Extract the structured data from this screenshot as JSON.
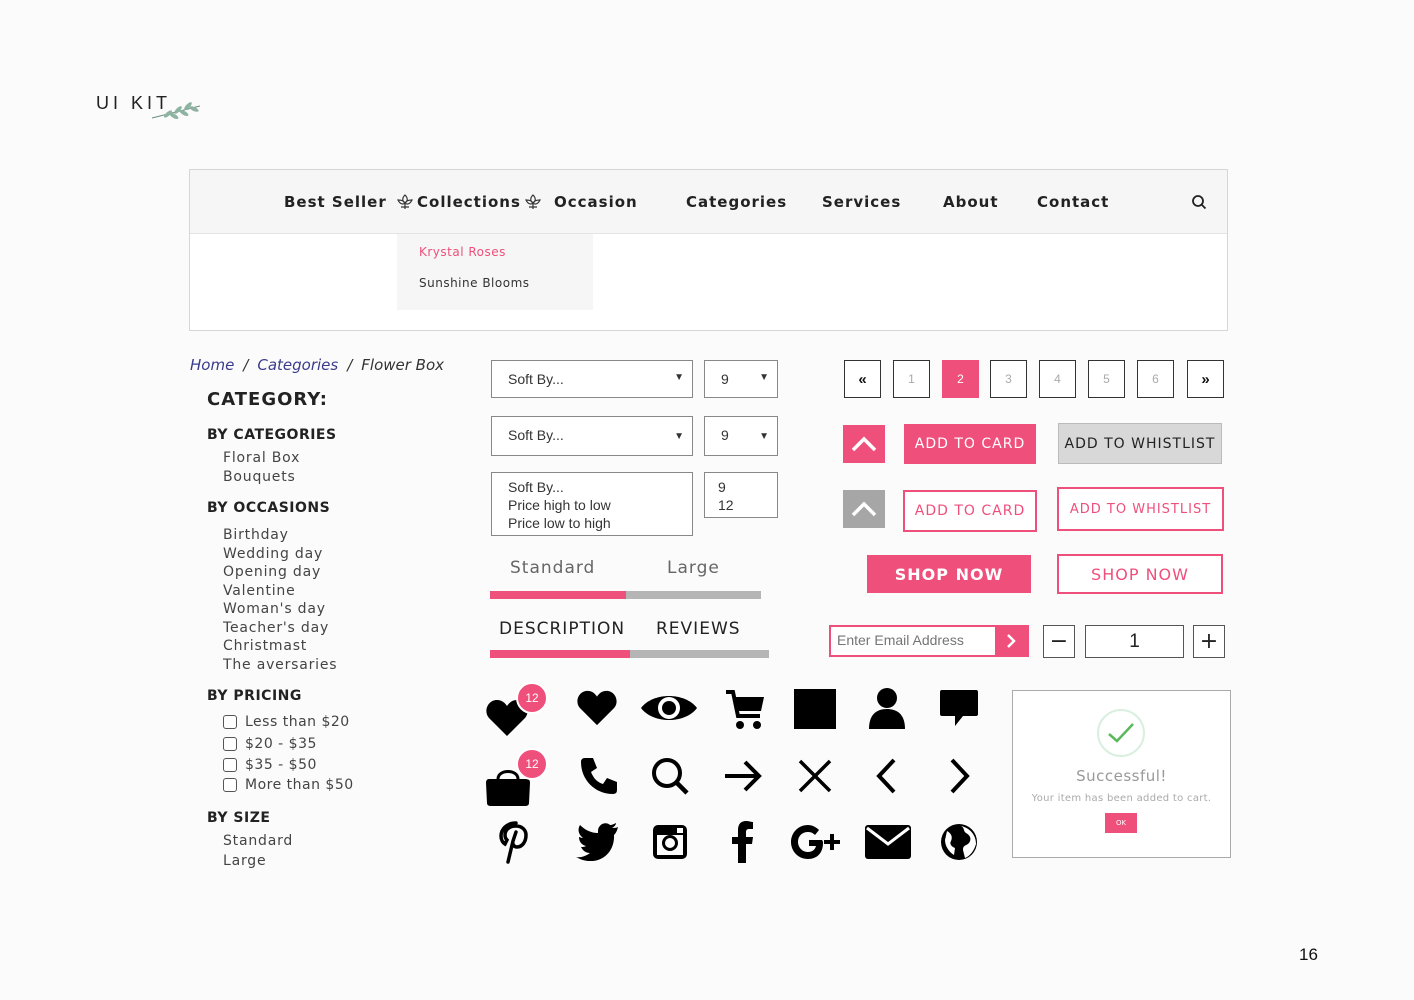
{
  "title": "UI KIT",
  "nav": {
    "items": [
      "Best Seller",
      "Collections",
      "Occasion",
      "Categories",
      "Services",
      "About",
      "Contact"
    ],
    "dropdown": [
      "Krystal Roses",
      "Sunshine Blooms"
    ]
  },
  "breadcrumb": {
    "home": "Home",
    "categories": "Categories",
    "current": "Flower Box",
    "sep": "/"
  },
  "sidebar": {
    "title": "CATEGORY:",
    "by_categories": {
      "heading": "BY CATEGORIES",
      "items": [
        "Floral Box",
        "Bouquets"
      ]
    },
    "by_occasions": {
      "heading": "BY OCCASIONS",
      "items": [
        "Birthday",
        "Wedding day",
        "Opening day",
        "Valentine",
        "Woman's day",
        "Teacher's day",
        "Christmast",
        "The aversaries"
      ]
    },
    "by_pricing": {
      "heading": "BY PRICING",
      "items": [
        "Less than $20",
        "$20 - $35",
        "$35 - $50",
        "More than $50"
      ]
    },
    "by_size": {
      "heading": "BY SIZE",
      "items": [
        "Standard",
        "Large"
      ]
    }
  },
  "selects": {
    "sort_label": "Soft By...",
    "count_value": "9",
    "sort_options": [
      "Price high to low",
      "Price low to high"
    ],
    "count_options": [
      "12"
    ],
    "arrow": "▼"
  },
  "size_tabs": [
    "Standard",
    "Large"
  ],
  "info_tabs": [
    "DESCRIPTION",
    "REVIEWS"
  ],
  "pagination": {
    "prev": "«",
    "next": "»",
    "pages": [
      "1",
      "2",
      "3",
      "4",
      "5",
      "6"
    ],
    "active": "2"
  },
  "buttons": {
    "add_to_card": "ADD TO CARD",
    "add_to_wishlist": "ADD TO WHISTLIST",
    "shop_now": "SHOP NOW"
  },
  "email": {
    "placeholder": "Enter Email Address"
  },
  "quantity": {
    "minus": "−",
    "value": "1",
    "plus": "+"
  },
  "badges": {
    "wishlist_count": "12",
    "cart_count": "12"
  },
  "modal": {
    "title": "Successful!",
    "message": "Your item has been added to cart.",
    "ok": "OK"
  },
  "page_number": "16",
  "colors": {
    "accent": "#ef4f7b",
    "gray_bar": "#b5b5b5",
    "success": "#5cb85c"
  }
}
